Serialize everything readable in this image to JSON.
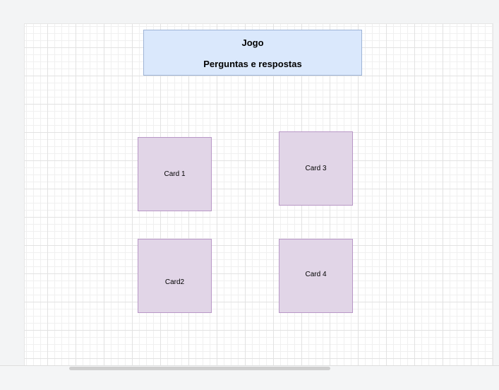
{
  "diagram": {
    "title_box": {
      "title": "Jogo",
      "subtitle": "Perguntas e respostas"
    },
    "cards": {
      "card1": "Card 1",
      "card2": "Card2",
      "card3": "Card 3",
      "card4": "Card 4"
    }
  },
  "colors": {
    "title_fill": "#dae8fc",
    "title_stroke": "#9db3d6",
    "card_fill": "#e1d5e7",
    "card_stroke": "#b897c6",
    "grid_line": "#e2e2e2"
  }
}
